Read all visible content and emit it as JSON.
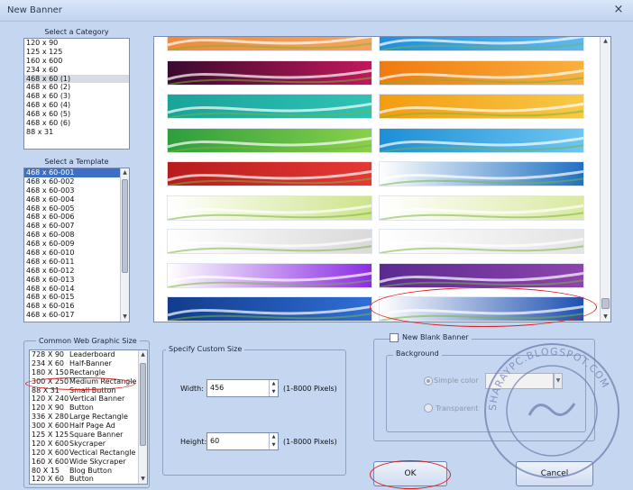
{
  "window": {
    "title": "New Banner",
    "close_glyph": "×"
  },
  "category": {
    "caption": "Select a Category",
    "items": [
      "120 x 90",
      "125 x 125",
      "160 x 600",
      "234 x 60",
      "468 x 60 (1)",
      "468 x 60 (2)",
      "468 x 60 (3)",
      "468 x 60 (4)",
      "468 x 60 (5)",
      "468 x 60 (6)",
      "88 x 31"
    ],
    "selected_index": 4
  },
  "template": {
    "caption": "Select a Template",
    "items": [
      "468 x 60-001",
      "468 x 60-002",
      "468 x 60-003",
      "468 x 60-004",
      "468 x 60-005",
      "468 x 60-006",
      "468 x 60-007",
      "468 x 60-008",
      "468 x 60-009",
      "468 x 60-010",
      "468 x 60-011",
      "468 x 60-012",
      "468 x 60-013",
      "468 x 60-014",
      "468 x 60-015",
      "468 x 60-016",
      "468 x 60-017"
    ],
    "selected_index": 0
  },
  "common": {
    "legend": "Common Web Graphic Size",
    "items": [
      {
        "size": "728 X 90",
        "name": "Leaderboard"
      },
      {
        "size": "234 X 60",
        "name": "Half-Banner"
      },
      {
        "size": "180 X 150",
        "name": "Rectangle"
      },
      {
        "size": "300 X 250",
        "name": "Medium Rectangle"
      },
      {
        "size": "88 X 31",
        "name": "Small Button"
      },
      {
        "size": "120 X 240",
        "name": "Vertical Banner"
      },
      {
        "size": "120 X 90",
        "name": "Button"
      },
      {
        "size": "336 X 280",
        "name": "Large Rectangle"
      },
      {
        "size": "300 X 600",
        "name": "Half Page Ad"
      },
      {
        "size": "125 X 125",
        "name": "Square Banner"
      },
      {
        "size": "120 X 600",
        "name": "Skycraper"
      },
      {
        "size": "120 X 600",
        "name": "Vectical Rectangle"
      },
      {
        "size": "160 X 600",
        "name": "Wide Skycraper"
      },
      {
        "size": "80 X 15",
        "name": "Blog Button"
      },
      {
        "size": "120 X 60",
        "name": "Button"
      }
    ]
  },
  "custom": {
    "legend": "Specify Custom Size",
    "width_label": "Width:",
    "width_value": "456",
    "height_label": "Height:",
    "height_value": "60",
    "range_text": "(1-8000 Pixels)"
  },
  "blank": {
    "checkbox_label": "New Blank Banner",
    "background_legend": "Background",
    "simple_color": "Simple color",
    "transparent": "Transparent"
  },
  "buttons": {
    "ok": "OK",
    "cancel": "Cancel"
  },
  "watermark": {
    "url": "SHARAYPC.BLOGSPOT.COM"
  },
  "colors": {
    "accent": "#3d6fc4",
    "annotation": "#dd2222"
  }
}
